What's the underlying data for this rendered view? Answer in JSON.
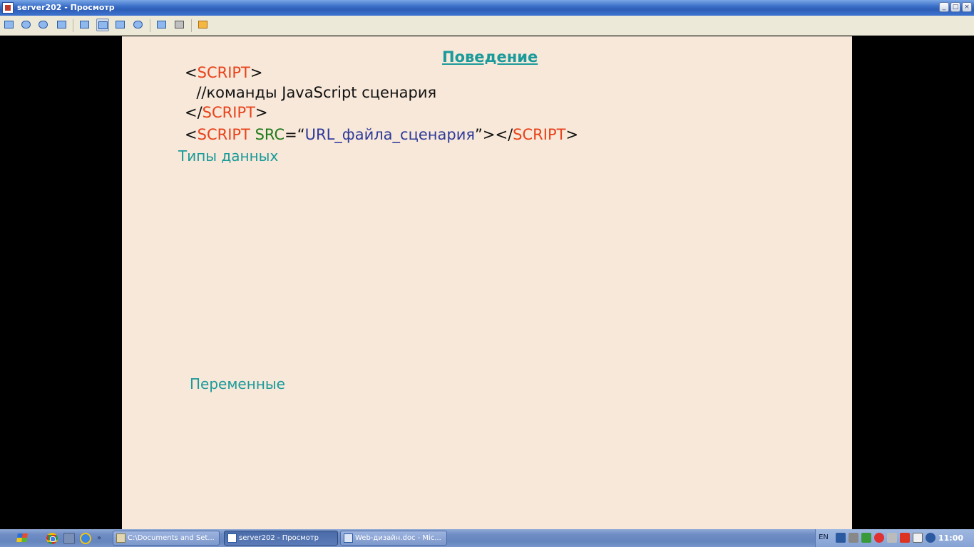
{
  "window": {
    "title": "server202 - Просмотр"
  },
  "toolbar": {
    "buttons": [
      "monitor-icon",
      "chat-icon",
      "phone-icon",
      "message-icon",
      "window-mode-icon",
      "fit-screen-icon",
      "fullscreen-icon",
      "zoom-icon",
      "screenshot-icon",
      "tools-icon",
      "close-session-icon"
    ]
  },
  "slide": {
    "title": "Поведение",
    "code_lines": {
      "line1": {
        "lt": "<",
        "tag": "SCRIPT",
        "gt": ">"
      },
      "line2": {
        "text": "  //команды JavaScript сценария"
      },
      "line3": {
        "lt": "</",
        "tag": "SCRIPT",
        "gt": ">"
      },
      "line4": {
        "lt": "<",
        "tag": "SCRIPT",
        "space": " ",
        "attr": "SRC",
        "eq": "=“",
        "value": "URL_файла_сценария",
        "close": "”></",
        "tag2": "SCRIPT",
        "gt": ">"
      }
    },
    "section_types": "Типы данных",
    "section_vars": "Переменные",
    "colors": {
      "background": "#f7e8d9",
      "heading": "#1a9a9a",
      "tag": "#e8421a",
      "attribute": "#207a1c",
      "value": "#2e3a9a"
    }
  },
  "taskbar": {
    "quicklaunch": [
      "chrome-icon",
      "folder-icon",
      "ie-icon"
    ],
    "more": "»",
    "tasks": [
      {
        "label": "C:\\Documents and Set..."
      },
      {
        "label": "server202 - Просмотр"
      },
      {
        "label": "Web-дизайн.doc - Mic..."
      }
    ],
    "language": "EN",
    "clock": "11:00"
  }
}
